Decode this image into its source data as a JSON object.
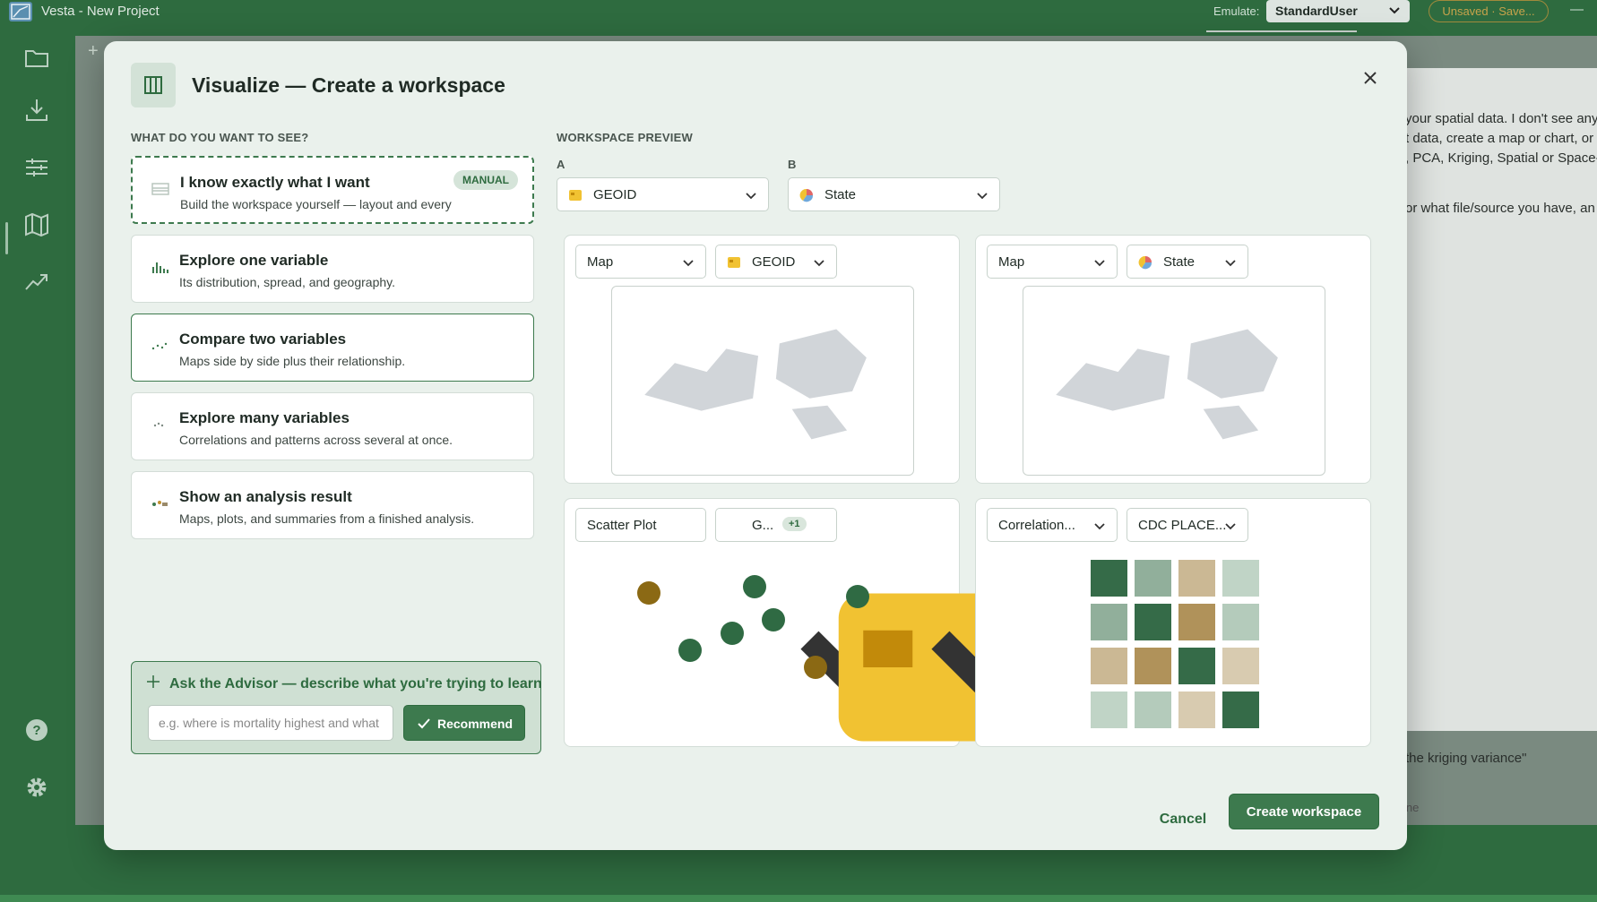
{
  "window": {
    "title": "Vesta - New Project",
    "emulate_label": "Emulate:",
    "emulate_value": "StandardUser",
    "unsaved_label": "Unsaved · Save..."
  },
  "rail": {
    "items": [
      {
        "icon": "folder-icon"
      },
      {
        "icon": "download-icon"
      },
      {
        "icon": "sliders-icon"
      },
      {
        "icon": "map-icon"
      },
      {
        "icon": "trend-icon"
      },
      {
        "icon": "help-icon"
      },
      {
        "icon": "gear-icon"
      }
    ]
  },
  "background": {
    "chat_lines": [
      "your spatial data. I don't see any",
      "t data, create a map or chart, or r",
      ", PCA, Kriging, Spatial or Space-T",
      " or what file/source you have, an"
    ],
    "input_hint": "the kriging variance\"",
    "footer_hint": "ine"
  },
  "modal": {
    "title": "Visualize — Create a workspace",
    "left_heading": "WHAT DO YOU WANT TO SEE?",
    "options": [
      {
        "title": "I know exactly what I want",
        "desc": "Build the workspace yourself — layout and every",
        "badge": "MANUAL"
      },
      {
        "title": "Explore one variable",
        "desc": "Its distribution, spread, and geography."
      },
      {
        "title": "Compare two variables",
        "desc": "Maps side by side plus their relationship."
      },
      {
        "title": "Explore many variables",
        "desc": "Correlations and patterns across several at once."
      },
      {
        "title": "Show an analysis result",
        "desc": "Maps, plots, and summaries from a finished analysis."
      }
    ],
    "advisor": {
      "title": "Ask the Advisor — describe what you're trying to learn",
      "placeholder": "e.g. where is mortality highest and what",
      "button": "Recommend"
    },
    "preview_heading": "WORKSPACE PREVIEW",
    "var_a": {
      "label": "A",
      "value": "GEOID"
    },
    "var_b": {
      "label": "B",
      "value": "State"
    },
    "panels": [
      {
        "type": "Map",
        "variable": "GEOID"
      },
      {
        "type": "Map",
        "variable": "State"
      },
      {
        "type": "Scatter Plot",
        "variable": "G...",
        "extra": "+1"
      },
      {
        "type": "Correlation...",
        "variable": "CDC PLACE..."
      }
    ],
    "cancel": "Cancel",
    "create": "Create workspace"
  },
  "colors": {
    "brand_green": "#3d7a4e",
    "dark_green": "#2e6b3f",
    "gold": "#8b6914",
    "heat": [
      [
        "#356b48",
        "#91af9b",
        "#cbb894",
        "#c0d4c6"
      ],
      [
        "#91af9b",
        "#356b48",
        "#b0925a",
        "#b4cbbb"
      ],
      [
        "#cbb894",
        "#b0925a",
        "#356b48",
        "#d8cbb0"
      ],
      [
        "#c0d4c6",
        "#b4cbbb",
        "#d8cbb0",
        "#356b48"
      ]
    ]
  }
}
